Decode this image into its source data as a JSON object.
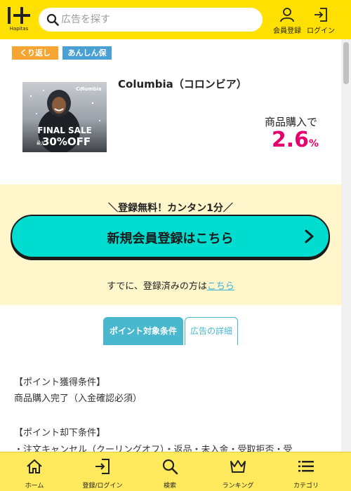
{
  "header": {
    "logo_text": "Hapitas",
    "search_placeholder": "広告を探す",
    "register_label": "会員登録",
    "login_label": "ログイン"
  },
  "tags": [
    "くり返しOK",
    "あんしん保証"
  ],
  "product": {
    "name": "Columbia（コロンビア）",
    "image": {
      "brand": "Columbia",
      "sale_line1": "FINAL SALE",
      "sale_prefix": "最大",
      "sale_line2": "30%OFF"
    },
    "rate_label": "商品購入で",
    "rate_value": "2.6",
    "rate_unit": "%"
  },
  "register": {
    "catch": "＼登録無料！カンタン1分／",
    "button_label": "新規会員登録はこちら",
    "login_prefix": "すでに、登録済みの方は",
    "login_link": "こちら"
  },
  "tabs": [
    "ポイント対象条件",
    "広告の詳細"
  ],
  "conditions": {
    "acquire_heading": "【ポイント獲得条件】",
    "acquire_text": "商品購入完了（入金確認必須）",
    "reject_heading": "【ポイント却下条件】",
    "reject_text": "・注文キャンセル（クーリングオフ）・返品・未入金・受取拒否・受"
  },
  "bottom_nav": [
    "ホーム",
    "登録/ログイン",
    "検索",
    "ランキング",
    "カテゴリ"
  ],
  "colors": {
    "header_bg": "#ffe000",
    "accent_pink": "#e6006e",
    "button_cyan": "#00ddd0",
    "tab_blue": "#49b8cf",
    "band_bg": "#fff6cc"
  }
}
